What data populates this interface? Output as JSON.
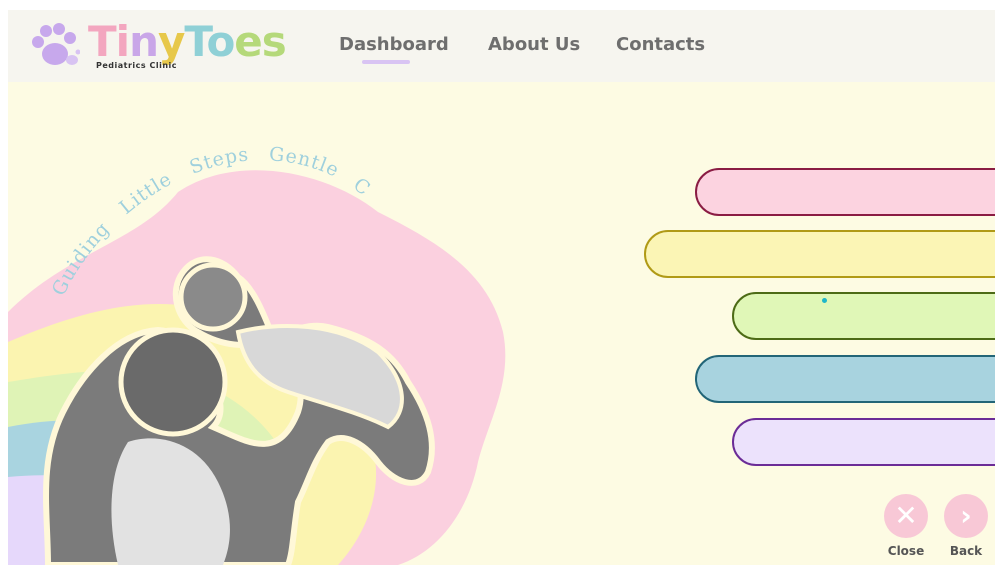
{
  "logo": {
    "letters": [
      "T",
      "i",
      "n",
      "y",
      "T",
      "o",
      "e",
      "s"
    ],
    "subtitle": "Pediatrics   Clinic"
  },
  "nav": {
    "items": [
      {
        "label": "Dashboard",
        "active": true
      },
      {
        "label": "About Us",
        "active": false
      },
      {
        "label": "Contacts",
        "active": false
      }
    ]
  },
  "tagline": {
    "words": [
      "Guiding",
      "Little",
      "Steps",
      "Gentle",
      "Care"
    ]
  },
  "menu_pills": [
    {
      "color": "#fcd3e0",
      "border": "#8a1c43"
    },
    {
      "color": "#fbf5b5",
      "border": "#b09a16"
    },
    {
      "color": "#e0f7b7",
      "border": "#4d6b16"
    },
    {
      "color": "#a8d3df",
      "border": "#226577"
    },
    {
      "color": "#ece2fc",
      "border": "#6b2c97"
    }
  ],
  "actions": {
    "close_label": "Close",
    "back_label": "Back",
    "close_icon": "✕",
    "back_icon": "›"
  },
  "colors": {
    "background": "#fdfbe3",
    "nav_text": "#6e6e6e",
    "accent_pink": "#f8c8d6",
    "tagline": "#9fd0dd"
  }
}
